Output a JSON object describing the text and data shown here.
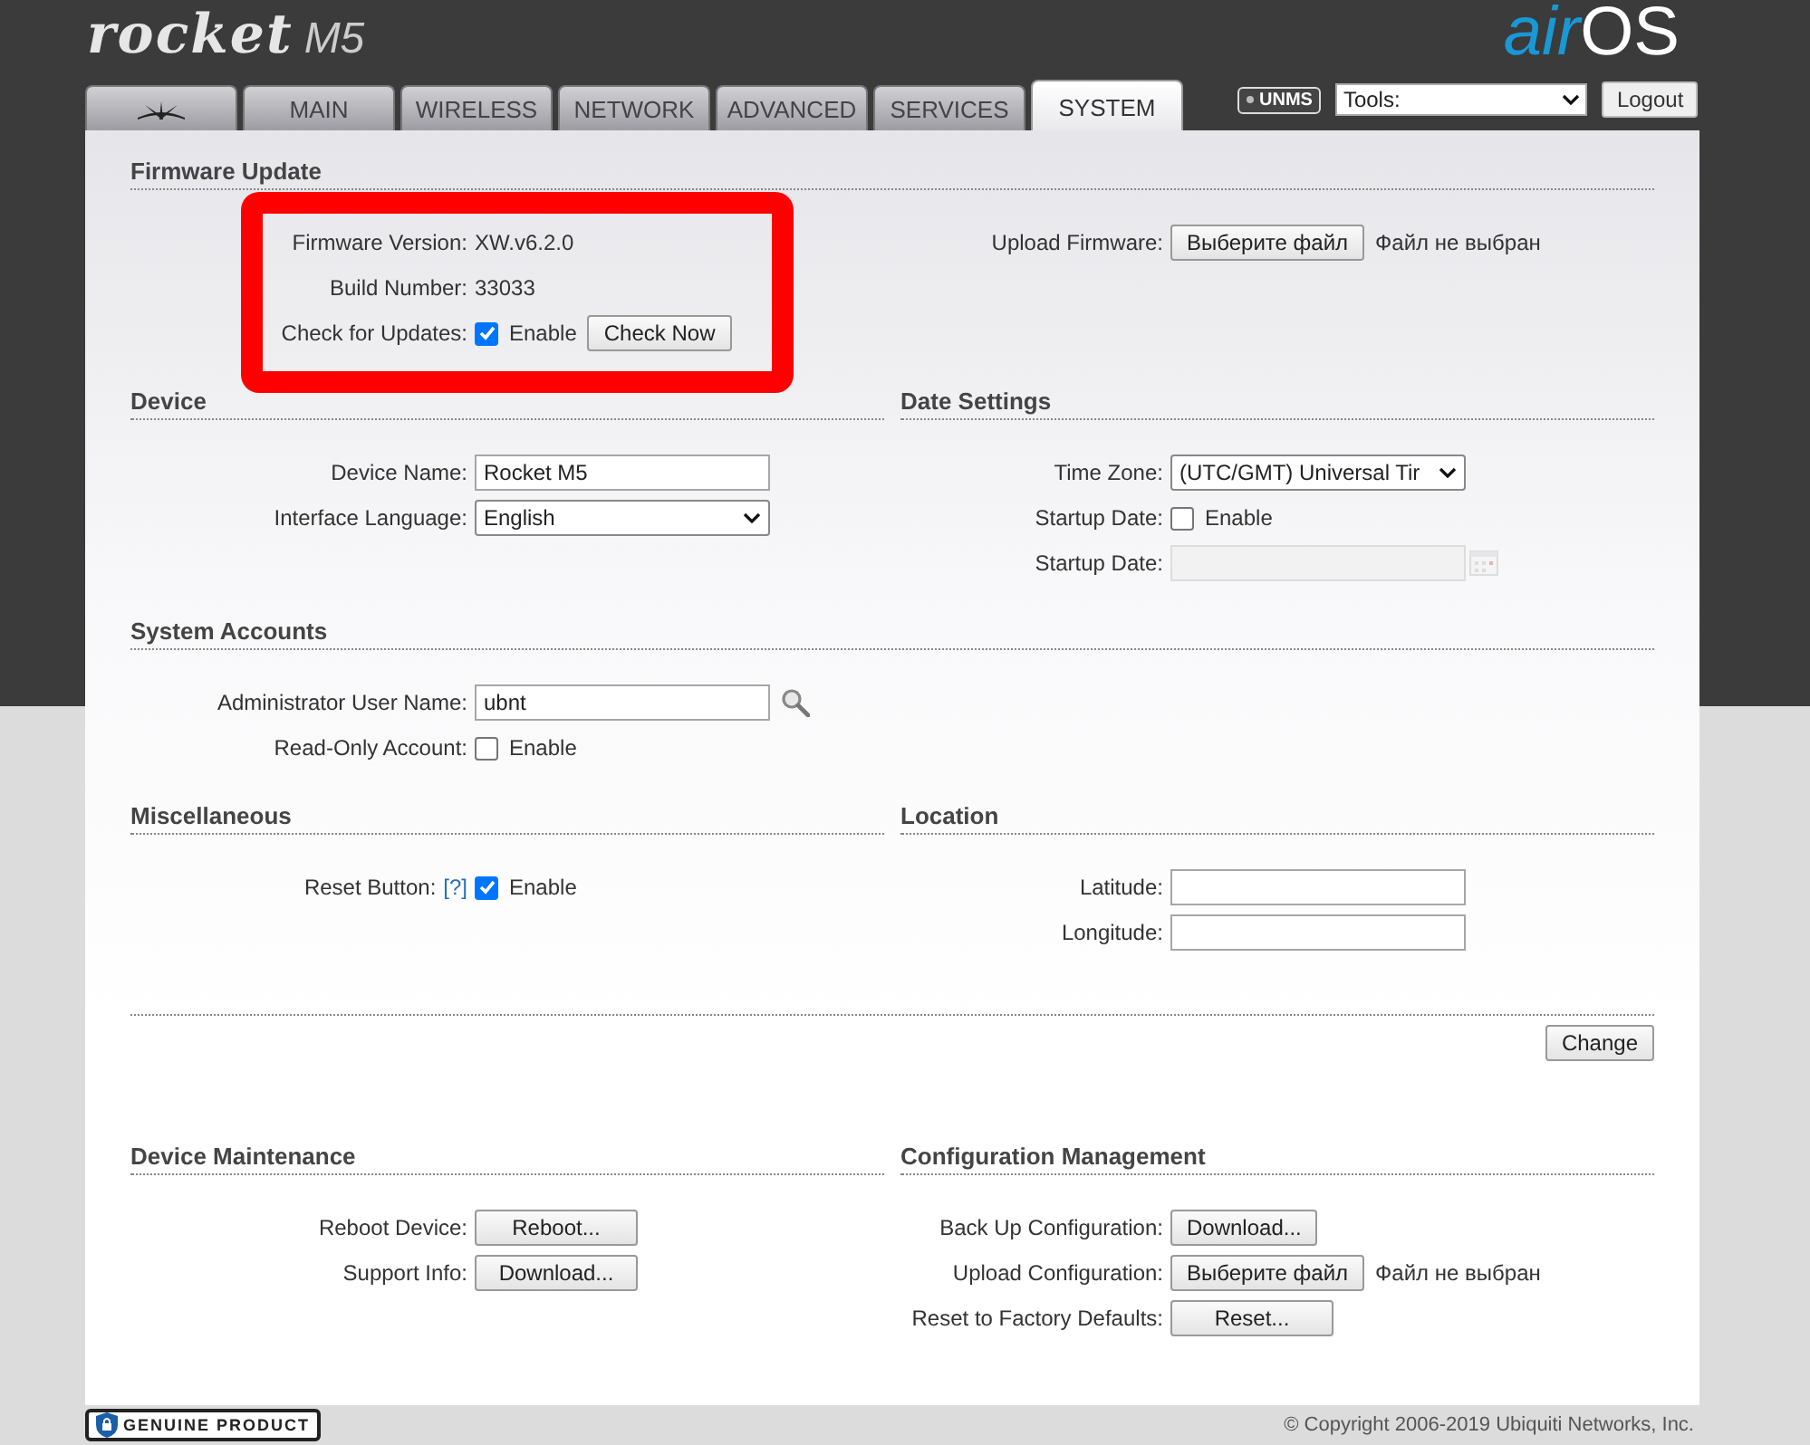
{
  "header": {
    "logo_name": "rocket",
    "logo_model": "M5",
    "brand_prefix": "air",
    "brand_suffix": "OS",
    "unms_badge": "UNMS",
    "tools_select": "Tools:",
    "logout_button": "Logout"
  },
  "tabs": [
    {
      "kind": "icon",
      "selected": false
    },
    {
      "kind": "text",
      "label": "MAIN",
      "selected": false
    },
    {
      "kind": "text",
      "label": "WIRELESS",
      "selected": false
    },
    {
      "kind": "text",
      "label": "NETWORK",
      "selected": false
    },
    {
      "kind": "text",
      "label": "ADVANCED",
      "selected": false
    },
    {
      "kind": "text",
      "label": "SERVICES",
      "selected": false
    },
    {
      "kind": "text",
      "label": "SYSTEM",
      "selected": true
    }
  ],
  "blocks": [
    {
      "kind": "wide",
      "title": "Firmware Update",
      "highlighted": true,
      "left": [
        {
          "label": "Firmware Version:",
          "controls": [
            {
              "kind": "text",
              "text": "XW.v6.2.0"
            }
          ]
        },
        {
          "label": "Build Number:",
          "controls": [
            {
              "kind": "text",
              "text": "33033"
            }
          ]
        },
        {
          "label": "Check for Updates:",
          "controls": [
            {
              "kind": "checkbox",
              "checked": true,
              "text": "Enable"
            },
            {
              "kind": "button",
              "text": "Check Now"
            }
          ]
        }
      ],
      "right": [
        {
          "label": "Upload Firmware:",
          "controls": [
            {
              "kind": "file",
              "button": "Выберите файл",
              "status": "Файл не выбран"
            }
          ]
        }
      ]
    },
    {
      "kind": "split",
      "columns": [
        {
          "title": "Device",
          "rows": [
            {
              "label": "Device Name:",
              "controls": [
                {
                  "kind": "input",
                  "value": "Rocket M5"
                }
              ]
            },
            {
              "label": "Interface Language:",
              "controls": [
                {
                  "kind": "select",
                  "value": "English"
                }
              ]
            }
          ]
        },
        {
          "title": "Date Settings",
          "rows": [
            {
              "label": "Time Zone:",
              "controls": [
                {
                  "kind": "select",
                  "value": "(UTC/GMT) Universal Tir"
                }
              ]
            },
            {
              "label": "Startup Date:",
              "controls": [
                {
                  "kind": "checkbox",
                  "checked": false,
                  "text": "Enable"
                }
              ]
            },
            {
              "label": "Startup Date:",
              "controls": [
                {
                  "kind": "date",
                  "disabled": true
                }
              ]
            }
          ]
        }
      ]
    },
    {
      "kind": "wide",
      "title": "System Accounts",
      "left": [
        {
          "label": "Administrator User Name:",
          "controls": [
            {
              "kind": "input",
              "value": "ubnt"
            },
            {
              "kind": "search_icon"
            }
          ]
        },
        {
          "label": "Read-Only Account:",
          "controls": [
            {
              "kind": "checkbox",
              "checked": false,
              "text": "Enable"
            }
          ]
        }
      ]
    },
    {
      "kind": "split",
      "columns": [
        {
          "title": "Miscellaneous",
          "rows": [
            {
              "label": "Reset Button:",
              "help": "[?]",
              "controls": [
                {
                  "kind": "checkbox",
                  "checked": true,
                  "text": "Enable"
                }
              ]
            }
          ]
        },
        {
          "title": "Location",
          "rows": [
            {
              "label": "Latitude:",
              "controls": [
                {
                  "kind": "input"
                }
              ]
            },
            {
              "label": "Longitude:",
              "controls": [
                {
                  "kind": "input"
                }
              ]
            }
          ]
        }
      ]
    },
    {
      "kind": "submit",
      "button": "Change"
    },
    {
      "kind": "split",
      "columns": [
        {
          "title": "Device Maintenance",
          "rows": [
            {
              "label": "Reboot Device:",
              "controls": [
                {
                  "kind": "button",
                  "text": "Reboot...",
                  "wide": true
                }
              ]
            },
            {
              "label": "Support Info:",
              "controls": [
                {
                  "kind": "button",
                  "text": "Download...",
                  "wide": true
                }
              ]
            }
          ]
        },
        {
          "title": "Configuration Management",
          "rows": [
            {
              "label": "Back Up Configuration:",
              "controls": [
                {
                  "kind": "button",
                  "text": "Download..."
                }
              ]
            },
            {
              "label": "Upload Configuration:",
              "controls": [
                {
                  "kind": "file",
                  "button": "Выберите файл",
                  "status": "Файл не выбран"
                }
              ]
            },
            {
              "label": "Reset to Factory Defaults:",
              "controls": [
                {
                  "kind": "button",
                  "text": "Reset...",
                  "wide": true
                }
              ]
            }
          ]
        }
      ]
    }
  ],
  "footer": {
    "badge": "GENUINE PRODUCT",
    "copyright": "© Copyright 2006-2019 Ubiquiti Networks, Inc."
  }
}
